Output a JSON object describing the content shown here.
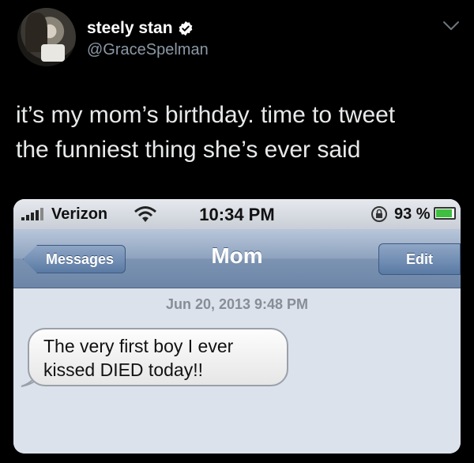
{
  "tweet": {
    "display_name": "steely stan",
    "handle": "@GraceSpelman",
    "text_lines": [
      "it’s my mom’s birthday. time to tweet",
      "the funniest thing she’s ever said"
    ]
  },
  "phone": {
    "carrier": "Verizon",
    "time": "10:34 PM",
    "battery": "93 %",
    "battery_level": 0.93,
    "nav": {
      "back_label": "Messages",
      "title": "Mom",
      "edit_label": "Edit"
    },
    "conversation": {
      "timestamp": "Jun 20, 2013 9:48 PM",
      "message_lines": [
        "The very first boy I ever",
        "kissed DIED today!!"
      ]
    }
  },
  "colors": {
    "background": "#000000",
    "handle": "#8b98a5",
    "verified": "#ffffff"
  }
}
